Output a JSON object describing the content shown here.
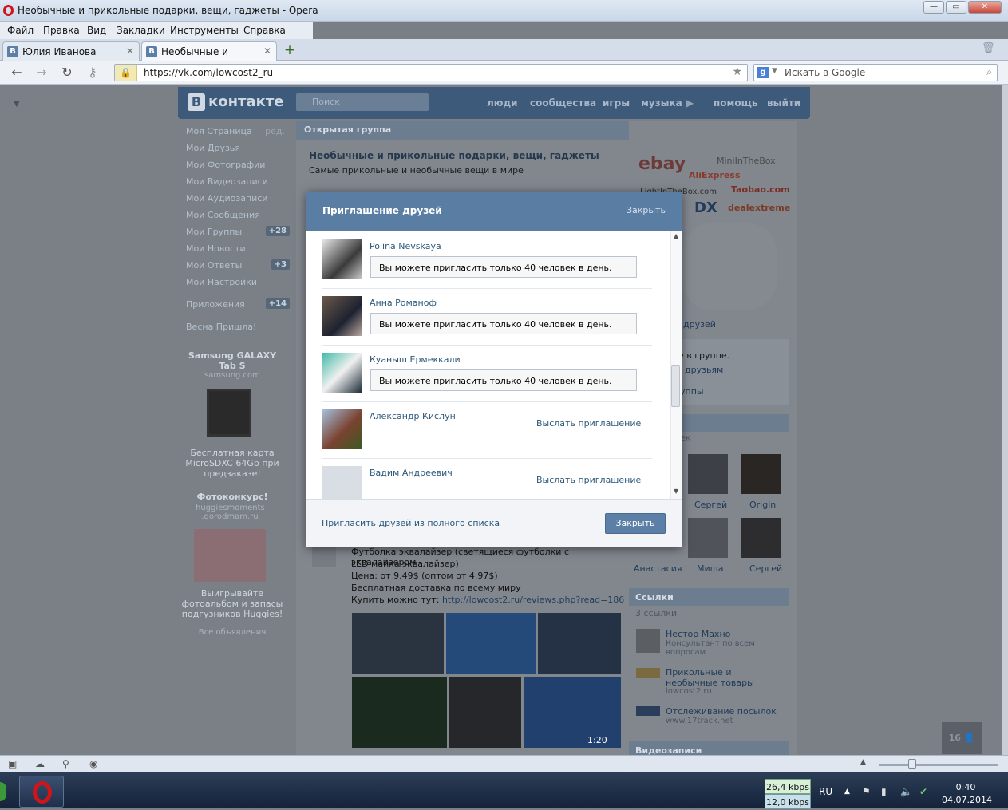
{
  "window": {
    "title": "Необычные и прикольные подарки, вещи, гаджеты - Opera",
    "controls": [
      "—",
      "▭",
      "✕"
    ]
  },
  "menu": [
    "Файл",
    "Правка",
    "Вид",
    "Закладки",
    "Инструменты",
    "Справка"
  ],
  "tabs": [
    {
      "label": "Юлия Иванова",
      "active": false
    },
    {
      "label": "Необычные и прикол...",
      "active": true
    }
  ],
  "address": {
    "url": "https://vk.com/lowcost2_ru",
    "search_placeholder": "Искать в Google"
  },
  "vk": {
    "logo": "контакте",
    "search_placeholder": "Поиск",
    "nav": [
      "люди",
      "сообщества",
      "игры",
      "музыка",
      "помощь",
      "выйти"
    ],
    "left_menu": [
      {
        "label": "Моя Страница",
        "extra": "ред."
      },
      {
        "label": "Мои Друзья",
        "extra": ""
      },
      {
        "label": "Мои Фотографии",
        "extra": ""
      },
      {
        "label": "Мои Видеозаписи",
        "extra": ""
      },
      {
        "label": "Мои Аудиозаписи",
        "extra": ""
      },
      {
        "label": "Мои Сообщения",
        "extra": ""
      },
      {
        "label": "Мои Группы",
        "extra": "+28"
      },
      {
        "label": "Мои Новости",
        "extra": ""
      },
      {
        "label": "Мои Ответы",
        "extra": "+3"
      },
      {
        "label": "Мои Настройки",
        "extra": ""
      },
      {
        "label": "Приложения",
        "extra": "+14"
      },
      {
        "label": "Весна Пришла!",
        "extra": ""
      }
    ],
    "ad1": {
      "title": "Samsung GALAXY Tab S",
      "domain": "samsung.com",
      "text": "Бесплатная карта MicroSDXC 64Gb при предзаказе!"
    },
    "ad2": {
      "title": "Фотоконкурс!",
      "domain": "huggiesmoments .gorodmam.ru",
      "text": "Выигрывайте фотоальбом и запасы подгузников Huggies!"
    },
    "all_ads": "Все объявления",
    "group_type": "Открытая группа",
    "group_name": "Необычные и прикольные подарки, вещи, гаджеты",
    "group_status": "Самые прикольные и необычные вещи в мире",
    "post": {
      "line1": "Футболка эквалайзер (светящиеся футболки с эквалайзером -",
      "line2": "LED майка эквалайзер)",
      "price": "Цена: от 9.49$ (оптом от 4.97$)",
      "delivery": "Бесплатная доставка по всему миру",
      "buy_prefix": "Купить можно тут:",
      "buy_link": "http://lowcost2.ru/reviews.php?read=186",
      "video_duration": "1:20"
    },
    "right": {
      "ad_brands": [
        "ebay",
        "MiniInTheBox",
        "AliExpress",
        "LightInTheBox.com",
        "Taobao.com",
        "DX",
        "dealextreme"
      ],
      "friends_link": "друзей",
      "in_group": "е в группе.",
      "to_friends": "друзьям",
      "groups": "уппы",
      "members_partial": "ек",
      "members": [
        "Сергей",
        "Origin",
        "Анастасия",
        "Миша",
        "Сергей"
      ],
      "links_title": "Ссылки",
      "links_count": "3 ссылки",
      "links": [
        {
          "name": "Нестор Махно",
          "desc": "Консультант по всем вопросам"
        },
        {
          "name": "Прикольные и необычные товары",
          "desc": "lowcost2.ru"
        },
        {
          "name": "Отслеживание посылок",
          "desc": "www.17track.net"
        }
      ],
      "videos_title": "Видеозаписи"
    },
    "online_counter": "16"
  },
  "dialog": {
    "title": "Приглашение друзей",
    "close_top": "Закрыть",
    "friends": [
      {
        "name": "Polina Nevskaya",
        "status": "Вы можете пригласить только 40 человек в день.",
        "invite": ""
      },
      {
        "name": "Анна Романоф",
        "status": "Вы можете пригласить только 40 человек в день.",
        "invite": ""
      },
      {
        "name": "Куаныш Ермеккали",
        "status": "Вы можете пригласить только 40 человек в день.",
        "invite": ""
      },
      {
        "name": "Александр Кислун",
        "status": "",
        "invite": "Выслать приглашение"
      },
      {
        "name": "Вадим Андреевич",
        "status": "",
        "invite": "Выслать приглашение"
      }
    ],
    "footer_link": "Пригласить друзей из полного списка",
    "close_button": "Закрыть"
  },
  "taskbar": {
    "down_speed": "26,4 kbps",
    "up_speed": "12,0 kbps",
    "lang": "RU",
    "time": "0:40",
    "date": "04.07.2014"
  }
}
